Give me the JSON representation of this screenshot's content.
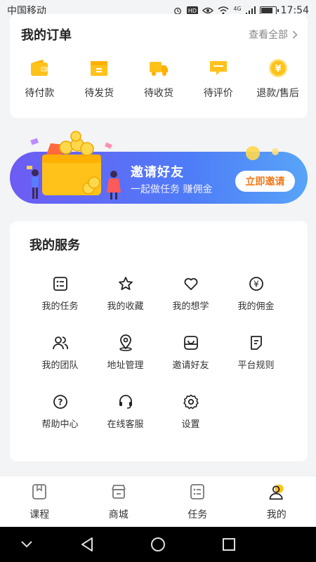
{
  "status_bar": {
    "carrier": "中国移动",
    "network": "4G",
    "time": "17:54",
    "battery_level": 0.85
  },
  "orders": {
    "title": "我的订单",
    "view_all": "查看全部",
    "items": [
      {
        "label": "待付款",
        "icon": "wallet-icon"
      },
      {
        "label": "待发货",
        "icon": "package-icon"
      },
      {
        "label": "待收货",
        "icon": "truck-icon"
      },
      {
        "label": "待评价",
        "icon": "comment-icon"
      },
      {
        "label": "退款/售后",
        "icon": "yen-coin-icon"
      }
    ]
  },
  "banner": {
    "title": "邀请好友",
    "subtitle": "一起做任务 赚佣金",
    "button": "立即邀请"
  },
  "services": {
    "title": "我的服务",
    "items": [
      {
        "label": "我的任务",
        "icon": "task-list-icon"
      },
      {
        "label": "我的收藏",
        "icon": "star-icon"
      },
      {
        "label": "我的想学",
        "icon": "heart-icon"
      },
      {
        "label": "我的佣金",
        "icon": "yen-circle-icon"
      },
      {
        "label": "我的团队",
        "icon": "team-icon"
      },
      {
        "label": "地址管理",
        "icon": "location-icon"
      },
      {
        "label": "邀请好友",
        "icon": "invite-icon"
      },
      {
        "label": "平台规则",
        "icon": "rules-icon"
      },
      {
        "label": "帮助中心",
        "icon": "help-icon"
      },
      {
        "label": "在线客服",
        "icon": "headset-icon"
      },
      {
        "label": "设置",
        "icon": "gear-icon"
      }
    ]
  },
  "tabs": [
    {
      "label": "课程",
      "icon": "book-icon",
      "active": false
    },
    {
      "label": "商城",
      "icon": "store-icon",
      "active": false
    },
    {
      "label": "任务",
      "icon": "task-icon",
      "active": false
    },
    {
      "label": "我的",
      "icon": "profile-icon",
      "active": true
    }
  ],
  "colors": {
    "accent_yellow": "#ffc21a",
    "button_text_orange": "#f07a1a",
    "banner_start": "#6d5cf4",
    "banner_end": "#58a4f8"
  }
}
